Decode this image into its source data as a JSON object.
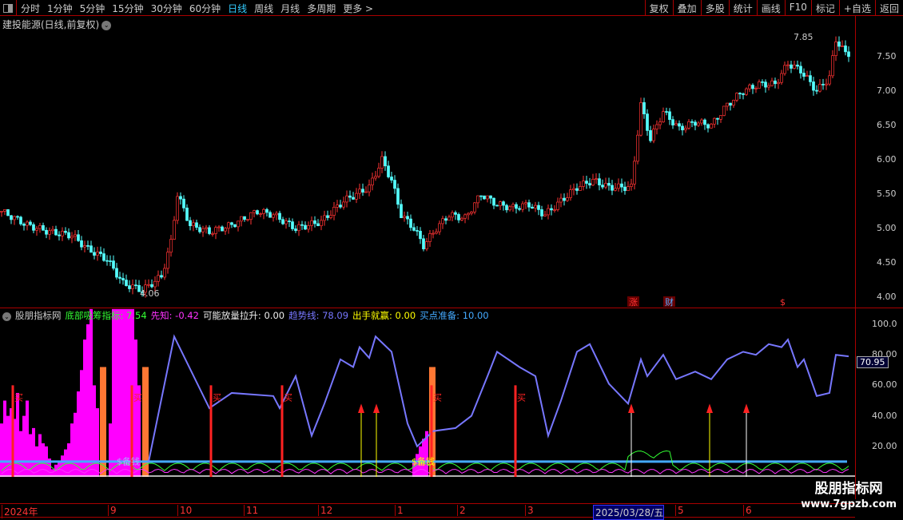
{
  "toolbar": {
    "periods": [
      "分时",
      "1分钟",
      "5分钟",
      "15分钟",
      "30分钟",
      "60分钟",
      "日线",
      "周线",
      "月线",
      "多周期",
      "更多 >"
    ],
    "active": "日线",
    "buttons": [
      "复权",
      "叠加",
      "多股",
      "统计",
      "画线",
      "F10",
      "标记",
      "+自选",
      "返回"
    ]
  },
  "stock_title": "建投能源(日线,前复权)",
  "price_axis": [
    "7.50",
    "7.00",
    "6.50",
    "6.00",
    "5.50",
    "5.00",
    "4.50",
    "4.00"
  ],
  "annotations": {
    "high": "7.85",
    "low": "4.06",
    "markers": [
      "涨",
      "财",
      "$"
    ]
  },
  "indicator": {
    "name": "股朋指标网",
    "items": [
      {
        "label": "底部吸筹指标:",
        "value": "7.54",
        "color": "#3f3"
      },
      {
        "label": "先知:",
        "value": "-0.42",
        "color": "#f3f"
      },
      {
        "label": "可能放量拉升:",
        "value": "0.00",
        "color": "#eee"
      },
      {
        "label": "趋势线:",
        "value": "78.09",
        "color": "#77f"
      },
      {
        "label": "出手就赢:",
        "value": "0.00",
        "color": "#ff0"
      },
      {
        "label": "买点准备:",
        "value": "10.00",
        "color": "#4af"
      }
    ],
    "axis": [
      "100.0",
      "80.00",
      "60.00",
      "40.00",
      "20.00"
    ],
    "current": "70.95",
    "signal_label": "买",
    "reserve_label": "$备钱"
  },
  "dates": [
    "2024年",
    "9",
    "10",
    "11",
    "12",
    "1",
    "2",
    "3",
    "2025/03/28/五",
    "5",
    "6"
  ],
  "watermark": {
    "name": "股朋指标网",
    "url": "www.7gpzb.com"
  },
  "chart_data": {
    "type": "candlestick",
    "price_points": [
      [
        0,
        5.25
      ],
      [
        8,
        5.05
      ],
      [
        15,
        4.95
      ],
      [
        22,
        4.9
      ],
      [
        27,
        4.7
      ],
      [
        33,
        4.55
      ],
      [
        38,
        4.2
      ],
      [
        44,
        4.1
      ],
      [
        50,
        4.3
      ],
      [
        53,
        4.8
      ],
      [
        55,
        5.5
      ],
      [
        59,
        5.05
      ],
      [
        65,
        4.95
      ],
      [
        72,
        5.05
      ],
      [
        80,
        5.25
      ],
      [
        85,
        5.2
      ],
      [
        92,
        5.0
      ],
      [
        100,
        5.1
      ],
      [
        107,
        5.4
      ],
      [
        115,
        5.6
      ],
      [
        119,
        6.0
      ],
      [
        122,
        5.7
      ],
      [
        125,
        5.2
      ],
      [
        129,
        5.0
      ],
      [
        132,
        4.75
      ],
      [
        136,
        5.0
      ],
      [
        140,
        5.2
      ],
      [
        145,
        5.15
      ],
      [
        150,
        5.5
      ],
      [
        155,
        5.35
      ],
      [
        160,
        5.3
      ],
      [
        165,
        5.35
      ],
      [
        170,
        5.2
      ],
      [
        175,
        5.4
      ],
      [
        180,
        5.6
      ],
      [
        185,
        5.7
      ],
      [
        190,
        5.6
      ],
      [
        197,
        5.6
      ],
      [
        200,
        6.8
      ],
      [
        203,
        6.3
      ],
      [
        207,
        6.7
      ],
      [
        212,
        6.45
      ],
      [
        217,
        6.55
      ],
      [
        222,
        6.5
      ],
      [
        227,
        6.8
      ],
      [
        232,
        7.0
      ],
      [
        237,
        7.1
      ],
      [
        242,
        7.1
      ],
      [
        246,
        7.4
      ],
      [
        250,
        7.3
      ],
      [
        255,
        7.0
      ],
      [
        259,
        7.2
      ],
      [
        261,
        7.75
      ],
      [
        264,
        7.55
      ]
    ],
    "trend": [
      [
        46,
        10
      ],
      [
        54,
        92
      ],
      [
        65,
        45
      ],
      [
        72,
        55
      ],
      [
        85,
        53
      ],
      [
        87,
        45
      ],
      [
        92,
        66
      ],
      [
        97,
        27
      ],
      [
        101,
        48
      ],
      [
        106,
        77
      ],
      [
        110,
        72
      ],
      [
        112,
        85
      ],
      [
        115,
        78
      ],
      [
        117,
        92
      ],
      [
        122,
        82
      ],
      [
        127,
        35
      ],
      [
        130,
        20
      ],
      [
        135,
        30
      ],
      [
        142,
        32
      ],
      [
        147,
        40
      ],
      [
        152,
        66
      ],
      [
        155,
        82
      ],
      [
        162,
        72
      ],
      [
        167,
        66
      ],
      [
        171,
        27
      ],
      [
        175,
        50
      ],
      [
        180,
        82
      ],
      [
        184,
        87
      ],
      [
        190,
        61
      ],
      [
        196,
        48
      ],
      [
        200,
        77
      ],
      [
        202,
        66
      ],
      [
        207,
        80
      ],
      [
        211,
        64
      ],
      [
        217,
        69
      ],
      [
        222,
        64
      ],
      [
        227,
        77
      ],
      [
        232,
        82
      ],
      [
        236,
        80
      ],
      [
        240,
        87
      ],
      [
        244,
        85
      ],
      [
        246,
        90
      ],
      [
        249,
        72
      ],
      [
        251,
        77
      ],
      [
        255,
        53
      ],
      [
        259,
        55
      ],
      [
        261,
        80
      ],
      [
        265,
        79
      ]
    ],
    "signals": [
      4,
      41,
      66,
      88,
      163,
      161
    ],
    "arrows": [
      113,
      117,
      197,
      222,
      233
    ],
    "ylim": [
      0,
      105
    ]
  }
}
